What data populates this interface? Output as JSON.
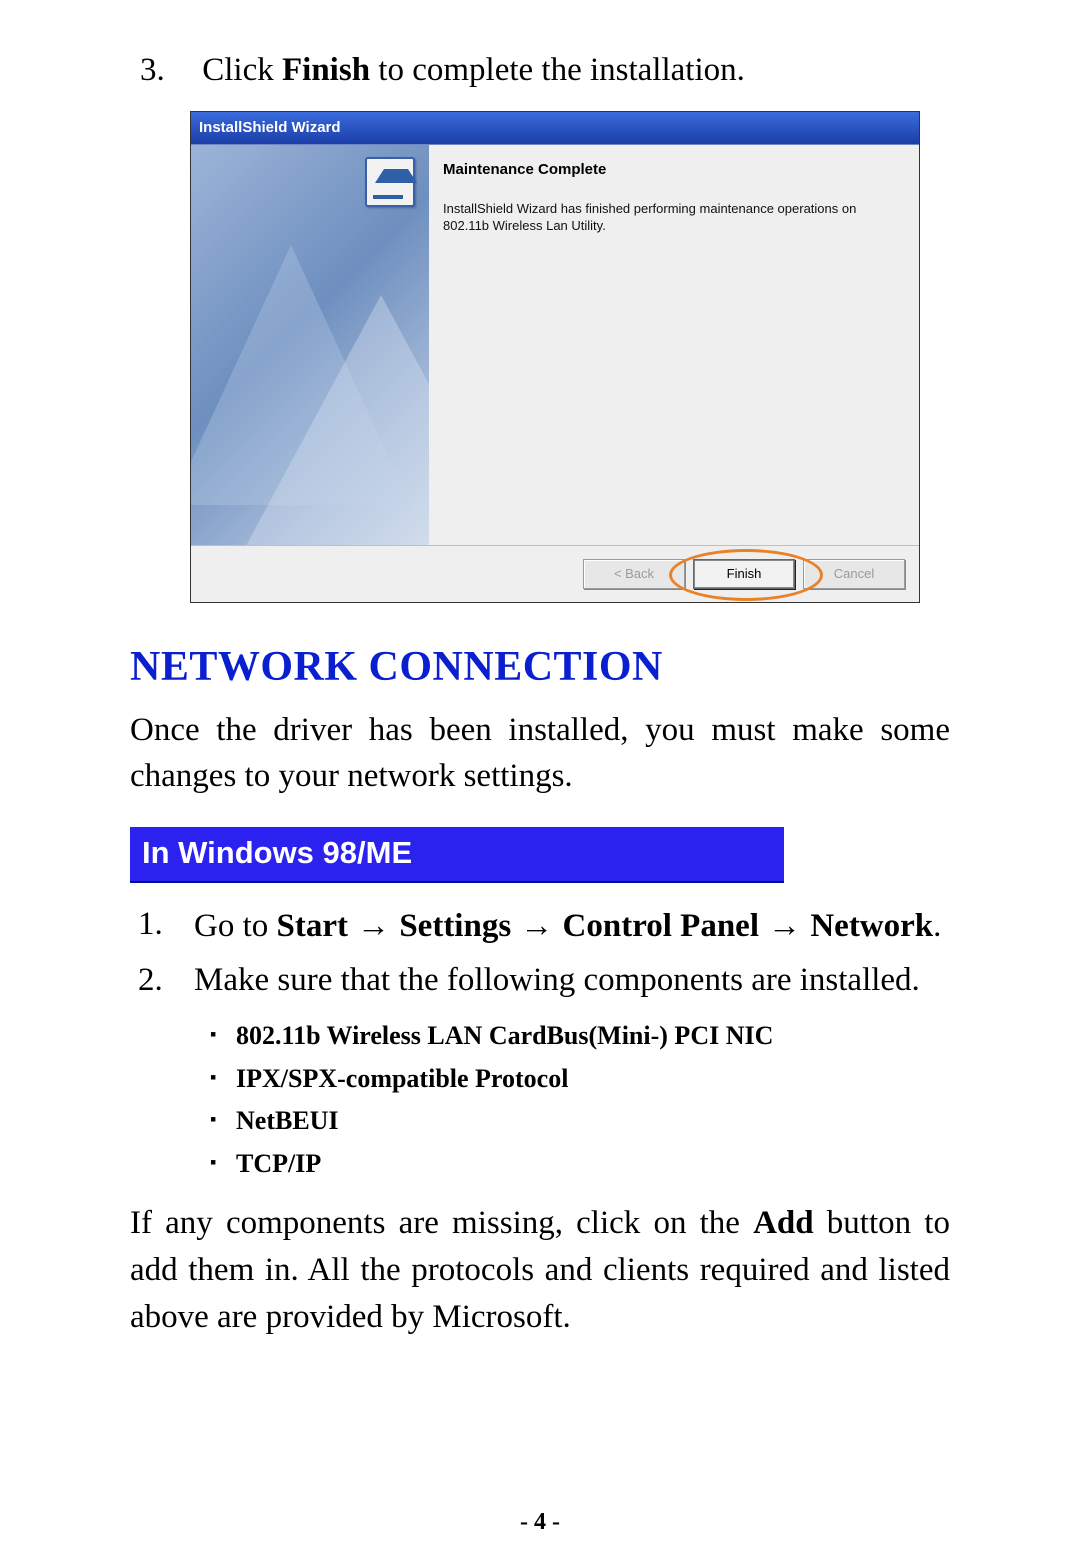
{
  "step3": {
    "num": "3.",
    "pre": "Click ",
    "bold": "Finish",
    "post": " to complete the installation."
  },
  "dialog": {
    "title": "InstallShield Wizard",
    "heading": "Maintenance Complete",
    "message": "InstallShield Wizard has finished performing maintenance operations on 802.11b Wireless Lan Utility.",
    "buttons": {
      "back": "< Back",
      "finish": "Finish",
      "cancel": "Cancel"
    }
  },
  "section_title": "NETWORK CONNECTION",
  "intro": "Once the driver has been installed, you must make some changes to your network settings.",
  "banner": "In Windows 98/ME",
  "list": {
    "item1": {
      "num": "1.",
      "pre": "Go to ",
      "b1": "Start",
      "arr": " → ",
      "b2": "Settings",
      "b3": "Control Panel",
      "b4": "Network",
      "dot": "."
    },
    "item2": {
      "num": "2.",
      "text": "Make sure that the following components are installed."
    }
  },
  "components": [
    "802.11b Wireless LAN CardBus(Mini-) PCI NIC",
    "IPX/SPX-compatible Protocol",
    "NetBEUI",
    "TCP/IP"
  ],
  "tail": {
    "pre": "If any components are missing, click on the ",
    "bold": "Add",
    "post": " button to add them in.  All the protocols and clients required and listed above are provided by Microsoft."
  },
  "page_number": "- 4 -"
}
